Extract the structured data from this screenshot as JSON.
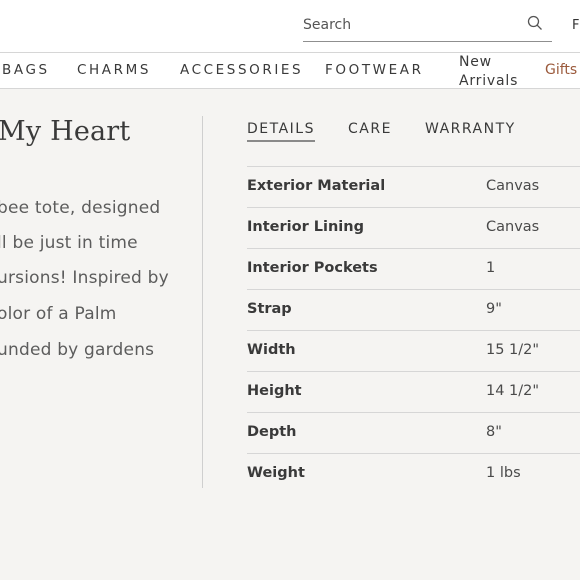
{
  "header": {
    "search": {
      "placeholder": "Search"
    },
    "cut_off_link": "F"
  },
  "nav": {
    "items": [
      "BAGS",
      "CHARMS",
      "ACCESSORIES",
      "FOOTWEAR"
    ],
    "new_arrivals": "New Arrivals",
    "gifts": "Gifts"
  },
  "product": {
    "title": "My Heart",
    "description_lines": [
      "bee tote, designed",
      "ll be just in time",
      "ursions! Inspired by",
      "olor of a Palm",
      "unded by gardens"
    ]
  },
  "tabs": [
    "DETAILS",
    "CARE",
    "WARRANTY"
  ],
  "active_tab": "DETAILS",
  "specs": [
    {
      "label": "Exterior Material",
      "value": "Canvas"
    },
    {
      "label": "Interior Lining",
      "value": "Canvas"
    },
    {
      "label": "Interior Pockets",
      "value": "1"
    },
    {
      "label": "Strap",
      "value": "9\""
    },
    {
      "label": "Width",
      "value": "15 1/2\""
    },
    {
      "label": "Height",
      "value": "14 1/2\""
    },
    {
      "label": "Depth",
      "value": "8\""
    },
    {
      "label": "Weight",
      "value": "1 lbs"
    }
  ],
  "colors": {
    "accent_gifts": "#9b5a3c",
    "background": "#f5f4f2"
  }
}
